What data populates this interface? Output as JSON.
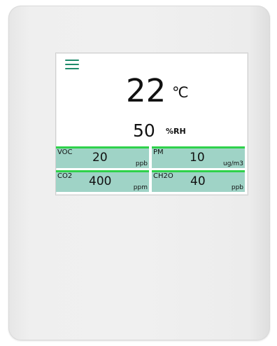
{
  "display": {
    "temperature": {
      "value": "22",
      "unit": "℃"
    },
    "humidity": {
      "value": "50",
      "unit": "%RH"
    },
    "sensors": [
      {
        "label": "VOC",
        "value": "20",
        "unit": "ppb"
      },
      {
        "label": "PM",
        "value": "10",
        "unit": "ug/m3"
      },
      {
        "label": "CO2",
        "value": "400",
        "unit": "ppm"
      },
      {
        "label": "CH2O",
        "value": "40",
        "unit": "ppb"
      }
    ]
  },
  "colors": {
    "tile_background": "#9fd3c6",
    "tile_border": "#2fd14b",
    "menu_icon": "#1f8a6b"
  },
  "icons": {
    "menu": "hamburger-menu-icon"
  }
}
